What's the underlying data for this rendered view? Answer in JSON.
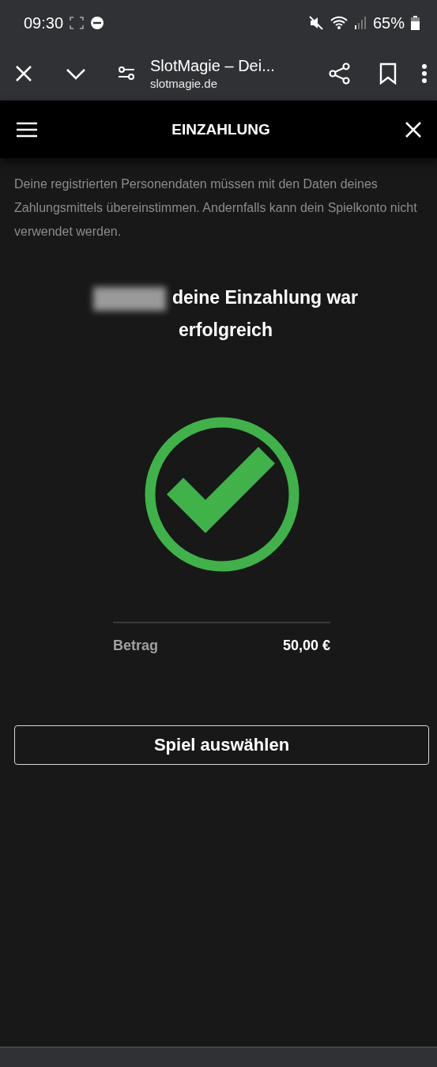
{
  "status_bar": {
    "time": "09:30",
    "battery": "65%"
  },
  "browser": {
    "title": "SlotMagie – Dei...",
    "url": "slotmagie.de"
  },
  "header": {
    "title": "EINZAHLUNG"
  },
  "notice": "Deine registrierten Personendaten müssen mit den Daten deines Zahlungsmittels übereinstimmen. Andernfalls kann dein Spielkonto nicht verwendet werden.",
  "success": {
    "message": "deine Einzahlung war erfolgreich"
  },
  "summary": {
    "label": "Betrag",
    "value": "50,00 €"
  },
  "buttons": [
    {
      "label": "Spiel auswählen"
    }
  ]
}
